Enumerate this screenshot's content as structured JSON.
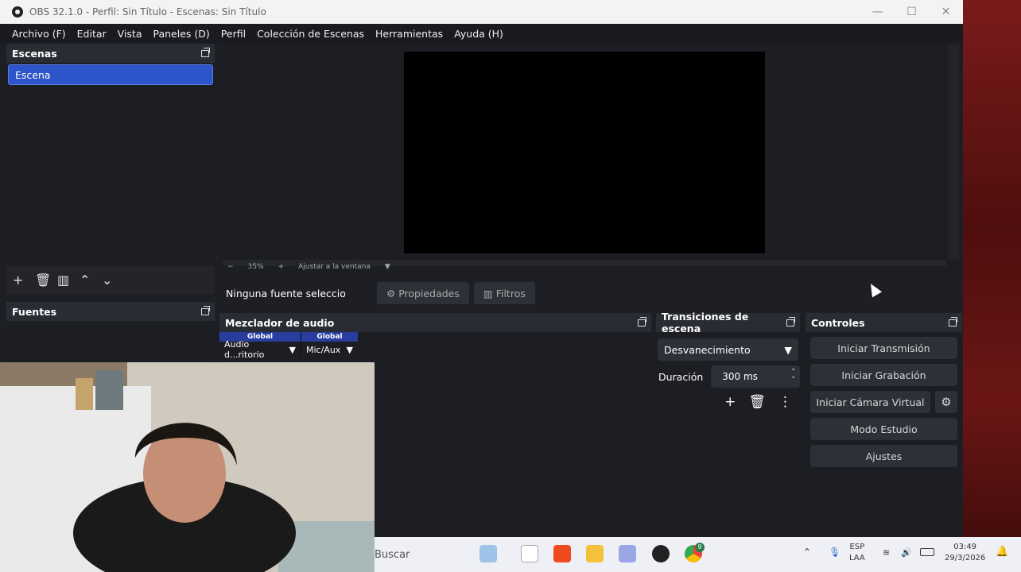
{
  "window": {
    "title": "OBS 32.1.0 - Perfil: Sin Título - Escenas: Sin Título",
    "controls": {
      "minimize": "—",
      "maximize": "☐",
      "close": "✕"
    }
  },
  "menu": [
    "Archivo (F)",
    "Editar",
    "Vista",
    "Paneles (D)",
    "Perfil",
    "Colección de Escenas",
    "Herramientas",
    "Ayuda (H)"
  ],
  "scenes": {
    "title": "Escenas",
    "items": [
      "Escena"
    ]
  },
  "sources": {
    "title": "Fuentes"
  },
  "preview": {
    "zoom": "35%",
    "fit_label": "Ajustar a la ventana"
  },
  "source_bar": {
    "selected": "Ninguna fuente seleccionada",
    "properties": "Propiedades",
    "filters": "Filtros"
  },
  "mixer": {
    "title": "Mezclador de audio",
    "channels": [
      {
        "scope": "Global",
        "name": "Audio d...ritorio"
      },
      {
        "scope": "Global",
        "name": "Mic/Aux"
      }
    ]
  },
  "transitions": {
    "title": "Transiciones de escena",
    "selected": "Desvanecimiento",
    "duration_label": "Duración",
    "duration_value": "300 ms"
  },
  "controls": {
    "title": "Controles",
    "start_stream": "Iniciar Transmisión",
    "start_record": "Iniciar Grabación",
    "start_vcam": "Iniciar Cámara Virtual",
    "studio_mode": "Modo Estudio",
    "settings": "Ajustes"
  },
  "taskbar": {
    "search_placeholder": "Buscar",
    "lang_top": "ESP",
    "lang_bottom": "LAA",
    "time": "03:49",
    "date": "29/3/2026",
    "chrome_badge": "9"
  },
  "colors": {
    "accent": "#2d54c8",
    "panel": "#1d1e24",
    "dock_title": "#2a2c34",
    "button": "#2e3038"
  }
}
